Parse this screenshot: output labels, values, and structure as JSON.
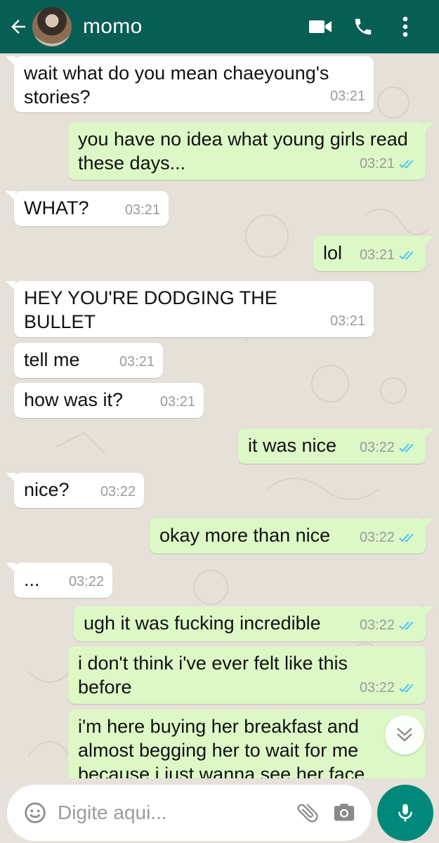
{
  "header": {
    "contact_name": "momo",
    "icons": [
      "back-arrow-icon",
      "video-call-icon",
      "voice-call-icon",
      "more-options-icon"
    ]
  },
  "messages": [
    {
      "dir": "in",
      "text": "wait what do you mean chaeyoung's stories?",
      "time": "03:21"
    },
    {
      "dir": "out",
      "text": "you have no idea what young girls read these days...",
      "time": "03:21",
      "read": true
    },
    {
      "dir": "in",
      "text": "WHAT?",
      "time": "03:21"
    },
    {
      "dir": "out",
      "text": "lol",
      "time": "03:21",
      "read": true
    },
    {
      "dir": "in",
      "text": "HEY YOU'RE DODGING THE BULLET",
      "time": "03:21"
    },
    {
      "dir": "in",
      "text": "tell me",
      "time": "03:21"
    },
    {
      "dir": "in",
      "text": "how was it?",
      "time": "03:21"
    },
    {
      "dir": "out",
      "text": "it was nice",
      "time": "03:22",
      "read": true
    },
    {
      "dir": "in",
      "text": "nice?",
      "time": "03:22"
    },
    {
      "dir": "out",
      "text": "okay more than nice",
      "time": "03:22",
      "read": true
    },
    {
      "dir": "in",
      "text": "...",
      "time": "03:22"
    },
    {
      "dir": "out",
      "text": "ugh it was fucking incredible",
      "time": "03:22",
      "read": true
    },
    {
      "dir": "out",
      "text": "i don't think i've ever felt like this before",
      "time": "03:22",
      "read": true
    },
    {
      "dir": "out",
      "text": "i'm here buying her breakfast and almost begging her to wait for me because i just wanna see her face",
      "time": "",
      "read": false
    }
  ],
  "input": {
    "placeholder": "Digite aqui..."
  },
  "colors": {
    "header": "#075e54",
    "incoming_bubble": "#ffffff",
    "outgoing_bubble": "#dcf8c6",
    "read_ticks": "#4fc3f7",
    "mic_button": "#00897b"
  }
}
